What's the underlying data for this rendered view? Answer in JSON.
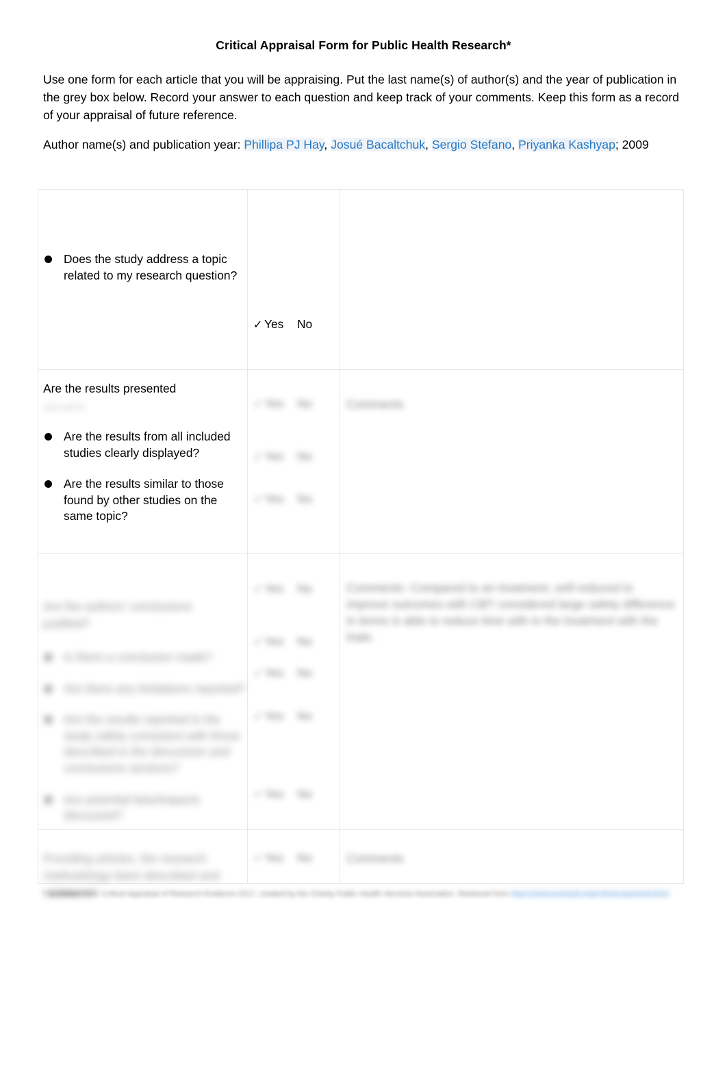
{
  "document": {
    "title": "Critical Appraisal Form for Public Health Research*",
    "intro": "Use one form for each article that you will be appraising. Put the last name(s) of author(s) and the year of publication in the grey box below. Record your answer to each question and keep track of your comments. Keep this form as a record of your appraisal of future reference.",
    "author_label": "Author name(s) and publication year: ",
    "authors": [
      "Phillipa PJ Hay",
      "Josué Bacaltchuk",
      "Sergio Stefano",
      "Priyanka Kashyap"
    ],
    "author_separator": ", ",
    "year_suffix": "; 2009",
    "link_color": "#2578c4"
  },
  "table": {
    "rows": [
      {
        "id": "row1",
        "heading": "",
        "bullets": [
          "Does the study address a topic related to my research question?"
        ],
        "answers": [
          {
            "check": "✓",
            "yes": "Yes",
            "no": "No"
          }
        ],
        "comments": "",
        "blur": "none"
      },
      {
        "id": "row2",
        "heading": "Are the results presented",
        "heading_second_line": "clearly? ...",
        "bullets": [
          "Are the results from all included studies clearly displayed?",
          "Are the results similar to those found by other studies on the same topic?"
        ],
        "answers": [
          {
            "check": "✓",
            "yes": "Yes",
            "no": "No"
          },
          {
            "check": "✓",
            "yes": "Yes",
            "no": "No"
          },
          {
            "check": "✓",
            "yes": "Yes",
            "no": "No"
          }
        ],
        "comments": "Comments",
        "blur": "partial"
      },
      {
        "id": "row3",
        "heading": "Are the authors' conclusions justified?",
        "bullets": [
          "Is there a conclusion made?",
          "Are there any limitations reported?",
          "Are the results reported in the study safely consistent with those described in the discussion and conclusions sections?",
          "Are potential bias/impacts discussed?"
        ],
        "answers": [
          {
            "check": "✓",
            "yes": "Yes",
            "no": "No"
          },
          {
            "check": "✓",
            "yes": "Yes",
            "no": "No"
          },
          {
            "check": "✓",
            "yes": "Yes",
            "no": "No"
          },
          {
            "check": "✓",
            "yes": "Yes",
            "no": "No"
          },
          {
            "check": "✓",
            "yes": "Yes",
            "no": "No"
          }
        ],
        "comments": "Comments: Compared to an treatment, self-reduced to improve outcomes with CBT considered large safety difference in terms is able to reduce time with in the treatment with the trials.",
        "blur": "full"
      },
      {
        "id": "row4",
        "heading": "Providing articles, the research methodology been described and validated?",
        "bullets": [],
        "answers": [
          {
            "check": "✓",
            "yes": "Yes",
            "no": "No"
          }
        ],
        "comments": "Comments",
        "blur": "full"
      }
    ]
  },
  "footnote": {
    "text": "* Scribbled from: Critical Appraisal of Research Evidence 2017, created by the Charity Public Health Services Association. Retrieved from ",
    "link": "https://www.example.org/critical-appraisal-form",
    "tail": ""
  }
}
